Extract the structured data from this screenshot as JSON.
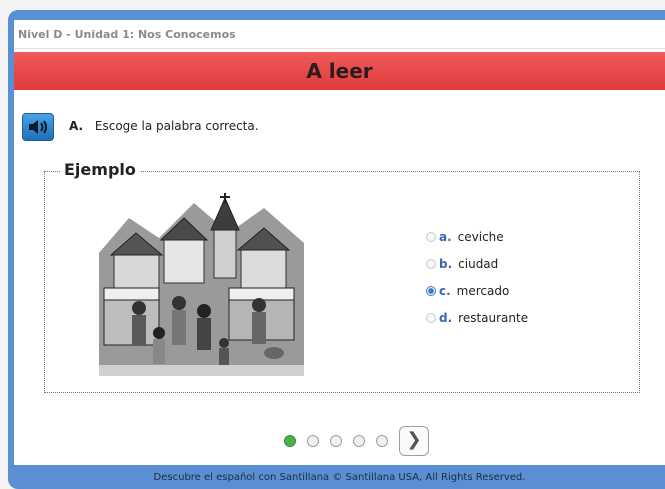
{
  "breadcrumb": "Nivel D - Unidad 1: Nos Conocemos",
  "title": "A leer",
  "instruction": {
    "letter": "A.",
    "text": "Escoge la palabra correcta."
  },
  "example_label": "Ejemplo",
  "options": [
    {
      "letter": "a.",
      "text": "ceviche",
      "selected": false
    },
    {
      "letter": "b.",
      "text": "ciudad",
      "selected": false
    },
    {
      "letter": "c.",
      "text": "mercado",
      "selected": true
    },
    {
      "letter": "d.",
      "text": "restaurante",
      "selected": false
    }
  ],
  "pager": {
    "pages": 5,
    "current": 1,
    "next_symbol": "❯"
  },
  "footer": "Descubre el español con Santillana © Santillana USA, All Rights Reserved.",
  "colors": {
    "accent_blue": "#5b8fd4",
    "title_red": "#e9494a",
    "active_dot": "#49b34a"
  }
}
